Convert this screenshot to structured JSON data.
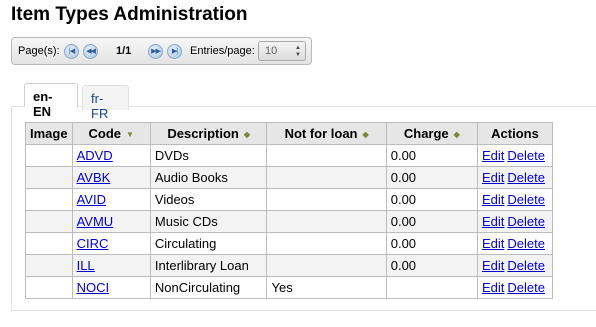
{
  "page": {
    "title": "Item Types Administration"
  },
  "pager": {
    "pages_label": "Page(s):",
    "pages_count": "1/1",
    "entries_label": "Entries/page:",
    "entries_value": "10",
    "icons": [
      "first-page-icon",
      "previous-page-icon",
      "next-page-icon",
      "last-page-icon"
    ]
  },
  "tabs": [
    {
      "label": "en-EN",
      "active": true
    },
    {
      "label": "fr-FR",
      "active": false
    }
  ],
  "table": {
    "headers": [
      "Image",
      "Code",
      "Description",
      "Not for loan",
      "Charge",
      "Actions"
    ],
    "rows": [
      {
        "image": "",
        "code": "ADVD",
        "description": "DVDs",
        "not_for_loan": "",
        "charge": "0.00",
        "edit": "Edit",
        "delete": "Delete"
      },
      {
        "image": "",
        "code": "AVBK",
        "description": "Audio Books",
        "not_for_loan": "",
        "charge": "0.00",
        "edit": "Edit",
        "delete": "Delete"
      },
      {
        "image": "",
        "code": "AVID",
        "description": "Videos",
        "not_for_loan": "",
        "charge": "0.00",
        "edit": "Edit",
        "delete": "Delete"
      },
      {
        "image": "",
        "code": "AVMU",
        "description": "Music CDs",
        "not_for_loan": "",
        "charge": "0.00",
        "edit": "Edit",
        "delete": "Delete"
      },
      {
        "image": "",
        "code": "CIRC",
        "description": "Circulating",
        "not_for_loan": "",
        "charge": "0.00",
        "edit": "Edit",
        "delete": "Delete"
      },
      {
        "image": "",
        "code": "ILL",
        "description": "Interlibrary Loan",
        "not_for_loan": "",
        "charge": "0.00",
        "edit": "Edit",
        "delete": "Delete"
      },
      {
        "image": "",
        "code": "NOCI",
        "description": "NonCirculating",
        "not_for_loan": "Yes",
        "charge": "",
        "edit": "Edit",
        "delete": "Delete"
      }
    ]
  },
  "colors": {
    "link": "#0000cc",
    "tab_inactive_text": "#17448a",
    "header_bg": "#e6e6e6"
  }
}
